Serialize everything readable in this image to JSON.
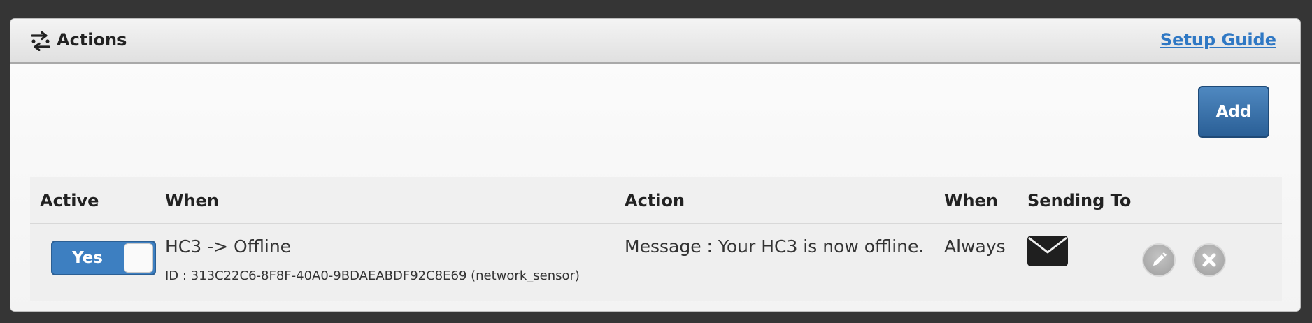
{
  "header": {
    "icon": "actions-icon",
    "title": "Actions",
    "setup_link": "Setup Guide"
  },
  "toolbar": {
    "add_label": "Add"
  },
  "table": {
    "columns": [
      "Active",
      "When",
      "Action",
      "When",
      "Sending To"
    ],
    "rows": [
      {
        "active": "Yes",
        "active_state": true,
        "when_title": "HC3 -> Offline",
        "when_id": "ID : 313C22C6-8F8F-40A0-9BDAEABDF92C8E69 (network_sensor)",
        "action": "Message : Your HC3 is now offline.",
        "when_freq": "Always",
        "sending_to_icon": "envelope-icon",
        "edit_icon": "pencil-icon",
        "delete_icon": "close-icon"
      }
    ]
  },
  "colors": {
    "accent": "#3d7fc1",
    "link": "#2f78c4",
    "background": "#353535"
  }
}
